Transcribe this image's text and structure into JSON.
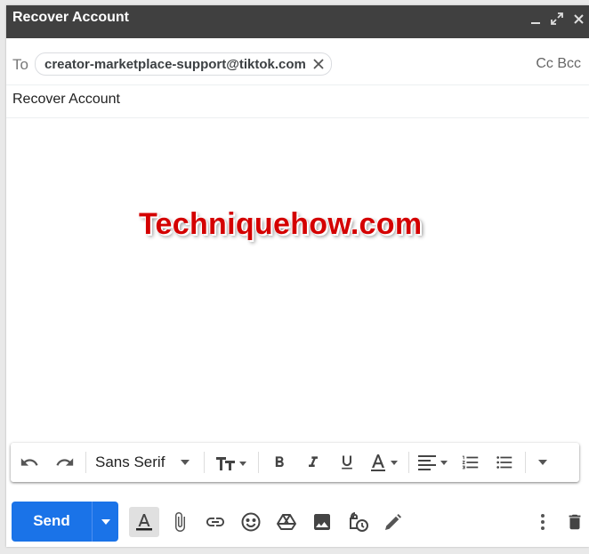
{
  "window": {
    "title": "Recover Account"
  },
  "compose": {
    "to_label": "To",
    "recipient": "creator-marketplace-support@tiktok.com",
    "cc_bcc": "Cc Bcc",
    "subject": "Recover Account",
    "body_watermark": "Techniquehow.com"
  },
  "format_toolbar": {
    "font": "Sans Serif",
    "icons": [
      "undo-icon",
      "redo-icon",
      "text-size-icon",
      "bold-icon",
      "italic-icon",
      "underline-icon",
      "text-color-icon",
      "align-icon",
      "numbered-list-icon",
      "bulleted-list-icon",
      "more-formatting-icon"
    ]
  },
  "bottom_toolbar": {
    "send_label": "Send",
    "icons": [
      "formatting-options-icon",
      "attach-icon",
      "link-icon",
      "emoji-icon",
      "drive-icon",
      "photo-icon",
      "confidential-mode-icon",
      "signature-icon",
      "more-options-icon",
      "discard-icon"
    ]
  },
  "colors": {
    "titlebar": "#404040",
    "send_button": "#1a73e8",
    "watermark": "#d40000"
  }
}
